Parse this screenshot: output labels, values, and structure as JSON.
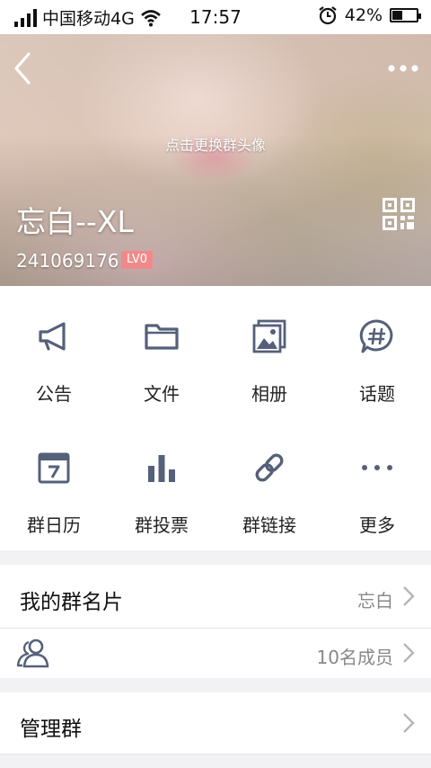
{
  "status_bar": {
    "carrier": "中国移动4G",
    "time": "17:57",
    "battery": "42%",
    "battery_level": 0.42,
    "icons": [
      "signal-icon",
      "wifi-icon",
      "alarm-icon",
      "battery-icon"
    ]
  },
  "header": {
    "avatar_hint": "点击更换群头像",
    "group_name": "忘白--XL",
    "group_id": "241069176",
    "level": "LV0",
    "icons": [
      "back-icon",
      "more-icon",
      "qr-code-icon"
    ]
  },
  "actions": [
    {
      "label": "公告",
      "icon": "megaphone-icon"
    },
    {
      "label": "文件",
      "icon": "folder-icon"
    },
    {
      "label": "相册",
      "icon": "photo-album-icon"
    },
    {
      "label": "话题",
      "icon": "topic-icon"
    },
    {
      "label": "群日历",
      "icon": "calendar-icon"
    },
    {
      "label": "群投票",
      "icon": "vote-icon"
    },
    {
      "label": "群链接",
      "icon": "link-icon"
    },
    {
      "label": "更多",
      "icon": "more-dots-icon"
    }
  ],
  "list": {
    "card_title": "我的群名片",
    "card_value": "忘白",
    "members_value": "10名成员",
    "manage_title": "管理群"
  },
  "colors": {
    "icon": "#55607a",
    "badge": "#f08a8a",
    "chevron": "#b5b5b5"
  }
}
